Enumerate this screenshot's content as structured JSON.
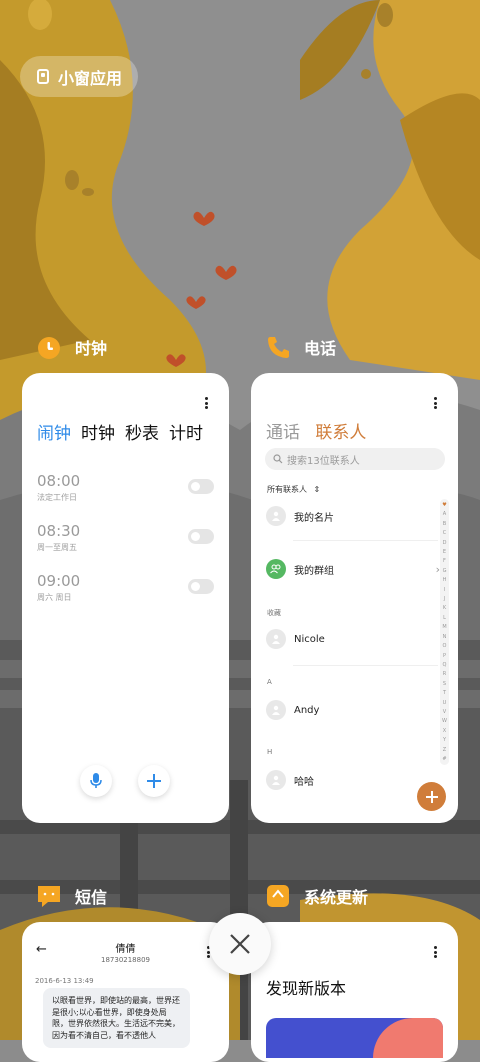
{
  "mini_window": {
    "label": "小窗应用"
  },
  "apps": {
    "clock": {
      "name": "时钟",
      "tabs": [
        "闹钟",
        "时钟",
        "秒表",
        "计时"
      ],
      "active_tab": "闹钟",
      "alarms": [
        {
          "time": "08:00",
          "repeat": "法定工作日",
          "enabled": false
        },
        {
          "time": "08:30",
          "repeat": "周一至周五",
          "enabled": false
        },
        {
          "time": "09:00",
          "repeat": "周六 周日",
          "enabled": false
        }
      ],
      "buttons": {
        "voice": "microphone-icon",
        "add": "plus-icon"
      }
    },
    "phone": {
      "name": "电话",
      "tabs": [
        "通话",
        "联系人"
      ],
      "active_tab": "联系人",
      "search_placeholder": "搜索13位联系人",
      "filter_label": "所有联系人",
      "contacts": {
        "my_card": "我的名片",
        "my_groups": "我的群组",
        "favorites_header": "收藏",
        "favorite": "Nicole",
        "section_a": "A",
        "contact_a": "Andy",
        "section_h": "H",
        "contact_h": "哈哈"
      },
      "alphabet": [
        "♥",
        "A",
        "B",
        "C",
        "D",
        "E",
        "F",
        "G",
        "H",
        "I",
        "J",
        "K",
        "L",
        "M",
        "N",
        "O",
        "P",
        "Q",
        "R",
        "S",
        "T",
        "U",
        "V",
        "W",
        "X",
        "Y",
        "Z",
        "#"
      ]
    },
    "sms": {
      "name": "短信",
      "contact_name": "倩倩",
      "contact_number": "18730218809",
      "date": "2016-6-13 13:49",
      "message": "以眼看世界，即使站的最高，世界还是很小;以心看世界，即使身处局限，世界依然很大。生活远不完美，因为看不清自己，看不透他人"
    },
    "update": {
      "name": "系统更新",
      "title": "发现新版本"
    }
  },
  "colors": {
    "accent_blue": "#2f8be8",
    "accent_orange": "#d07d3a",
    "app_icon_orange": "#f5a623"
  }
}
